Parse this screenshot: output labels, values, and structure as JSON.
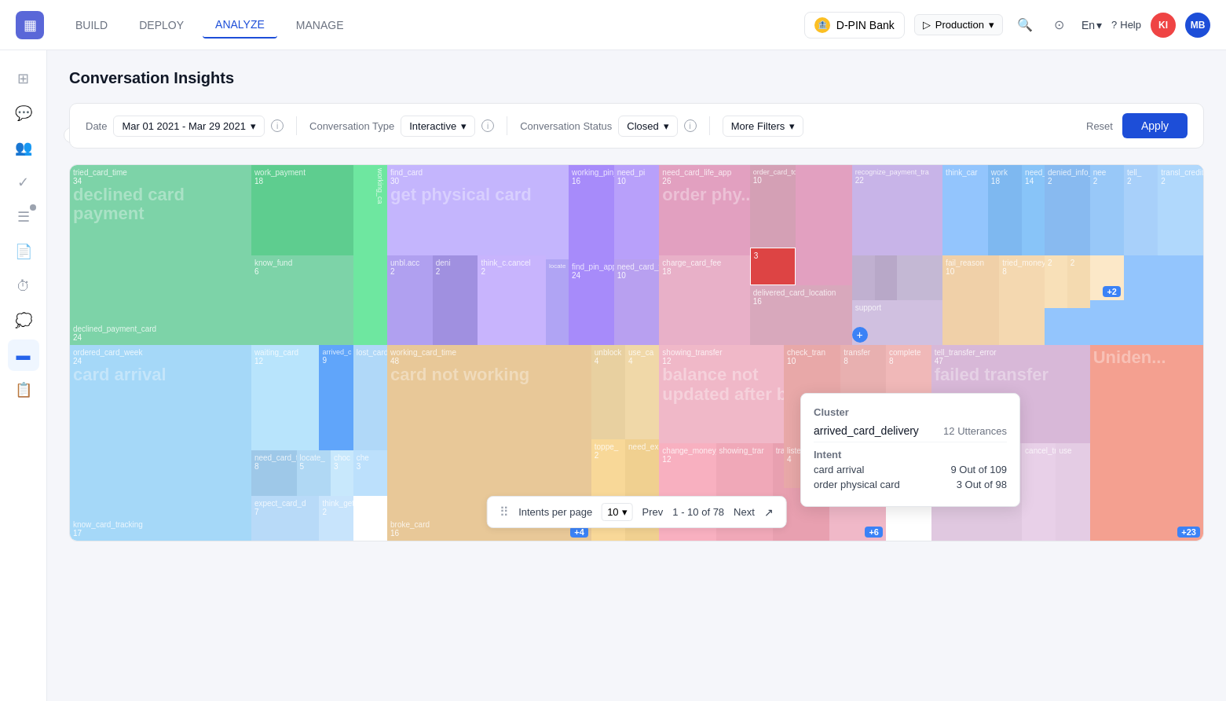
{
  "app": {
    "logo": "▦",
    "nav_links": [
      {
        "id": "build",
        "label": "BUILD"
      },
      {
        "id": "deploy",
        "label": "DEPLOY"
      },
      {
        "id": "analyze",
        "label": "ANALYZE",
        "active": true
      },
      {
        "id": "manage",
        "label": "MANAGE"
      }
    ],
    "bank": "D-PIN Bank",
    "environment": "Production",
    "lang": "En",
    "help": "Help",
    "avatar_ki": "KI",
    "avatar_mb": "MB"
  },
  "sidebar": {
    "items": [
      {
        "id": "grid",
        "icon": "⊞"
      },
      {
        "id": "chat",
        "icon": "💬"
      },
      {
        "id": "users",
        "icon": "👥"
      },
      {
        "id": "checklist",
        "icon": "✓"
      },
      {
        "id": "layers",
        "icon": "☰"
      },
      {
        "id": "report",
        "icon": "📄"
      },
      {
        "id": "clock",
        "icon": "⏱"
      },
      {
        "id": "comments",
        "icon": "💭"
      },
      {
        "id": "rectangle",
        "icon": "▬",
        "active": true
      },
      {
        "id": "document",
        "icon": "📋"
      }
    ]
  },
  "page": {
    "title": "Conversation Insights"
  },
  "filters": {
    "date_label": "Date",
    "date_value": "Mar 01 2021 - Mar 29 2021",
    "conv_type_label": "Conversation Type",
    "conv_type_value": "Interactive",
    "conv_status_label": "Conversation Status",
    "conv_status_value": "Closed",
    "more_filters_label": "More Filters",
    "reset_label": "Reset",
    "apply_label": "Apply"
  },
  "tooltip": {
    "cluster_label": "Cluster",
    "cluster_name": "arrived_card_delivery",
    "utterances": "12 Utterances",
    "intent_label": "Intent",
    "intents": [
      {
        "name": "card arrival",
        "count": "9 Out of 109"
      },
      {
        "name": "order physical card",
        "count": "3 Out of 98"
      }
    ]
  },
  "pagination": {
    "label": "Intents per page",
    "per_page": "10",
    "prev": "Prev",
    "range": "1 - 10 of 78",
    "next": "Next"
  }
}
